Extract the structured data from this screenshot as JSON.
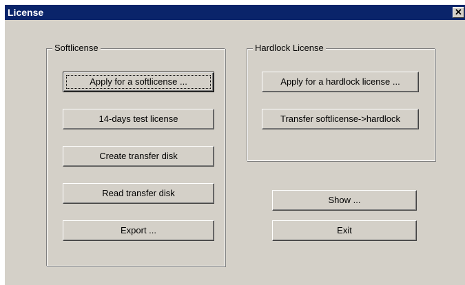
{
  "window": {
    "title": "License",
    "close_glyph": "✕"
  },
  "softlicense": {
    "legend": "Softlicense",
    "buttons": [
      "Apply for a softlicense ...",
      "14-days test license",
      "Create transfer disk",
      "Read transfer disk",
      "Export ..."
    ]
  },
  "hardlock": {
    "legend": "Hardlock License",
    "buttons": [
      "Apply for a hardlock license ...",
      "Transfer softlicense->hardlock"
    ]
  },
  "actions": {
    "show": "Show ...",
    "exit": "Exit"
  }
}
